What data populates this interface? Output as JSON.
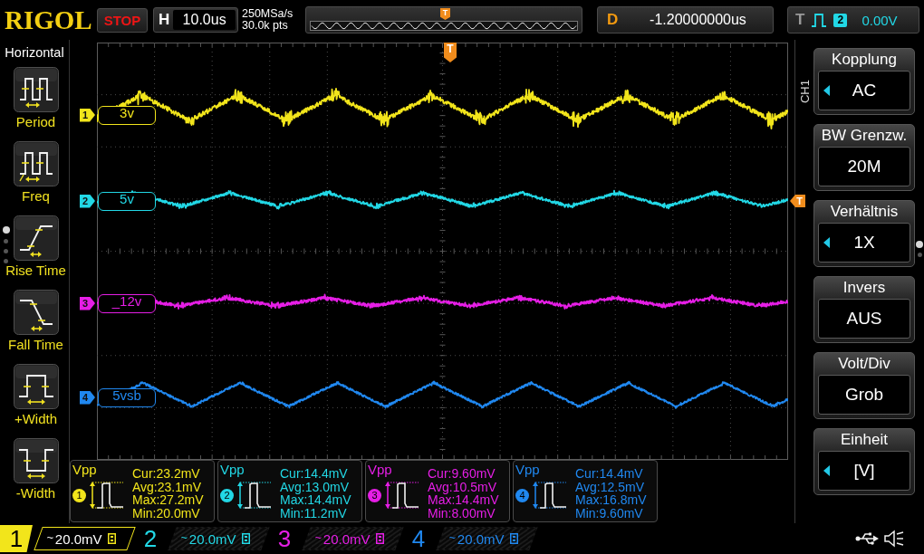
{
  "top_bar": {
    "brand": "RIGOL",
    "run_state": "STOP",
    "timebase": {
      "label": "H",
      "value": "10.0us"
    },
    "sample_rate": "250MSa/s",
    "memory_depth": "30.0k pts",
    "overview_marker": "T",
    "delay": {
      "label": "D",
      "value": "-1.20000000us"
    },
    "trigger": {
      "label": "T",
      "source": "2",
      "color": "#22d8e6",
      "level": "0.00V"
    }
  },
  "measure_menu": {
    "title": "Horizontal",
    "items": [
      {
        "kind": "period",
        "label": "Period"
      },
      {
        "kind": "frequency",
        "label": "Freq"
      },
      {
        "kind": "rise",
        "label": "Rise Time"
      },
      {
        "kind": "fall",
        "label": "Fall Time"
      },
      {
        "kind": "positive_width",
        "label": "+Width"
      },
      {
        "kind": "negative_width",
        "label": "-Width"
      }
    ],
    "pages": [
      {
        "selected": true
      },
      {
        "selected": false
      },
      {
        "selected": false
      },
      {
        "selected": false
      }
    ]
  },
  "screen": {
    "trigger_position_marker": "T",
    "trigger_level_marker": "T",
    "channels": [
      {
        "number": "1",
        "label": "3v",
        "color": "#f2e51b"
      },
      {
        "number": "2",
        "label": "5v",
        "color": "#22d8e6"
      },
      {
        "number": "3",
        "label": "_12v",
        "color": "#e61ee6"
      },
      {
        "number": "4",
        "label": "5vsb",
        "color": "#2088f0"
      }
    ]
  },
  "channel_menu": {
    "channel": "CH1",
    "items": [
      {
        "label": "Kopplung",
        "value": "AC",
        "adjustable": true
      },
      {
        "label": "BW Grenzw.",
        "value": "20M",
        "adjustable": false
      },
      {
        "label": "Verhältnis",
        "value": "1X",
        "adjustable": true
      },
      {
        "label": "Invers",
        "value": "AUS",
        "adjustable": false
      },
      {
        "label": "Volt/Div",
        "value": "Grob",
        "adjustable": false
      },
      {
        "label": "Einheit",
        "value": "[V]",
        "adjustable": true
      }
    ],
    "pages": [
      {
        "selected": true
      },
      {
        "selected": false
      }
    ]
  },
  "measurements": [
    {
      "name": "Vpp",
      "source": "1",
      "color": "#f2e51b",
      "values": [
        "Cur:23.2mV",
        "Avg:23.1mV",
        "Max:27.2mV",
        "Min:20.0mV"
      ]
    },
    {
      "name": "Vpp",
      "source": "2",
      "color": "#22d8e6",
      "values": [
        "Cur:14.4mV",
        "Avg:13.0mV",
        "Max:14.4mV",
        "Min:11.2mV"
      ]
    },
    {
      "name": "Vpp",
      "source": "3",
      "color": "#e61ee6",
      "values": [
        "Cur:9.60mV",
        "Avg:10.5mV",
        "Max:14.4mV",
        "Min:8.00mV"
      ]
    },
    {
      "name": "Vpp",
      "source": "4",
      "color": "#2088f0",
      "values": [
        "Cur:14.4mV",
        "Avg:12.5mV",
        "Max:16.8mV",
        "Min:9.60mV"
      ]
    }
  ],
  "status_bar": {
    "channels": [
      {
        "number": "1",
        "coupling": "~",
        "scale": "20.0mV",
        "selected": true,
        "color": "#f2e51b"
      },
      {
        "number": "2",
        "coupling": "~",
        "scale": "20.0mV",
        "selected": false,
        "color": "#22d8e6"
      },
      {
        "number": "3",
        "coupling": "~",
        "scale": "20.0mV",
        "selected": false,
        "color": "#e61ee6"
      },
      {
        "number": "4",
        "coupling": "~",
        "scale": "20.0mV",
        "selected": false,
        "color": "#2088f0"
      }
    ]
  }
}
